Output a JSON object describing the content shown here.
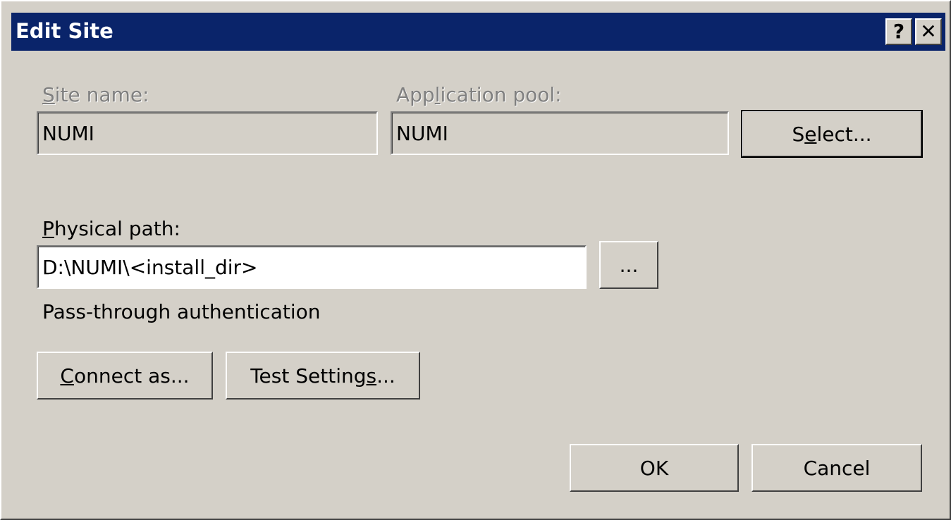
{
  "window": {
    "title": "Edit Site"
  },
  "caption_buttons": {
    "help": "?",
    "close": "✕"
  },
  "site_name": {
    "label": "Site name:",
    "value": "NUMI"
  },
  "application_pool": {
    "label": "Application pool:",
    "value": "NUMI"
  },
  "select_button": {
    "label": "Select..."
  },
  "physical_path": {
    "label": "Physical path:",
    "value": "D:\\NUMI\\<install_dir>"
  },
  "browse_button": {
    "label": "..."
  },
  "auth_text": "Pass-through authentication",
  "connect_as_button": {
    "label": "Connect as..."
  },
  "test_settings_button": {
    "label": "Test Settings..."
  },
  "ok_button": {
    "label": "OK"
  },
  "cancel_button": {
    "label": "Cancel"
  }
}
